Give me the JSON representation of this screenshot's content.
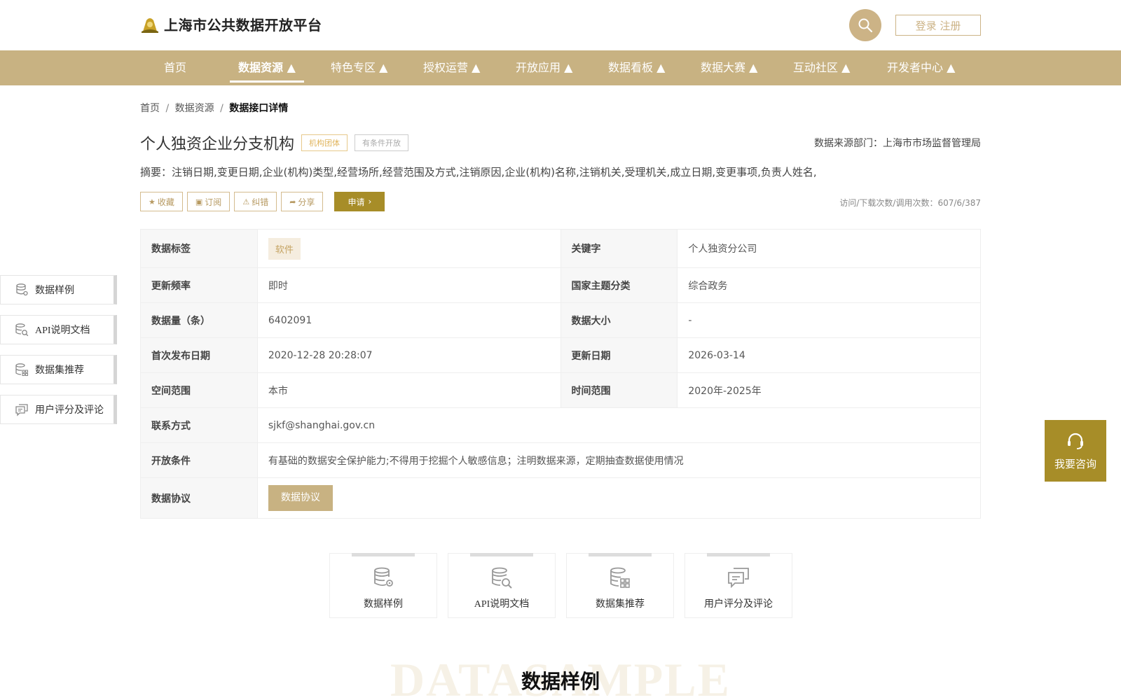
{
  "header": {
    "logo_text": "上海市公共数据开放平台",
    "login_label": "登录 注册"
  },
  "nav": [
    {
      "label": "首页"
    },
    {
      "label": "数据资源 ▲"
    },
    {
      "label": "特色专区 ▲"
    },
    {
      "label": "授权运营 ▲"
    },
    {
      "label": "开放应用 ▲"
    },
    {
      "label": "数据看板 ▲"
    },
    {
      "label": "数据大赛 ▲"
    },
    {
      "label": "互动社区 ▲"
    },
    {
      "label": "开发者中心 ▲"
    }
  ],
  "nav_active": "数据资源",
  "breadcrumb": {
    "home": "首页",
    "sep1": "/",
    "section": "数据资源",
    "sep2": "/",
    "current": "数据接口详情"
  },
  "detail": {
    "title": "个人独资企业分支机构",
    "tag_org": "机构团体",
    "tag_cond": "有条件开放",
    "source_dept": "数据来源部门：上海市市场监督管理局",
    "summary": "摘要：注销日期,变更日期,企业(机构)类型,经营场所,经营范围及方式,注销原因,企业(机构)名称,注销机关,受理机关,成立日期,变更事项,负责人姓名,",
    "stats": "访问/下载次数/调用次数：607/6/387"
  },
  "actions": {
    "favorite": "收藏",
    "subscribe": "订阅",
    "report": "纠错",
    "share": "分享",
    "apply": "申请"
  },
  "table": {
    "data_tag_label": "数据标签",
    "data_tag_value": "软件",
    "keyword_label": "关键字",
    "keyword_value": "个人独资分公司",
    "update_freq_label": "更新频率",
    "update_freq_value": "即时",
    "theme_label": "国家主题分类",
    "theme_value": "综合政务",
    "count_label": "数据量（条）",
    "count_value": "6402091",
    "size_label": "数据大小",
    "size_value": "-",
    "first_pub_label": "首次发布日期",
    "first_pub_value": "2020-12-28 20:28:07",
    "update_date_label": "更新日期",
    "update_date_value": "2026-03-14",
    "space_label": "空间范围",
    "space_value": "本市",
    "time_label": "时间范围",
    "time_value": "2020年-2025年",
    "contact_label": "联系方式",
    "contact_value": "sjkf@shanghai.gov.cn",
    "open_cond_label": "开放条件",
    "open_cond_value": "有基础的数据安全保护能力;不得用于挖掘个人敏感信息；注明数据来源，定期抽查数据使用情况",
    "protocol_label": "数据协议",
    "protocol_button": "数据协议"
  },
  "side_nav": [
    {
      "label": "数据样例"
    },
    {
      "label": "API说明文档"
    },
    {
      "label": "数据集推荐"
    },
    {
      "label": "用户评分及评论"
    }
  ],
  "consult": "我要咨询",
  "cards": [
    {
      "label": "数据样例"
    },
    {
      "label": "API说明文档"
    },
    {
      "label": "数据集推荐"
    },
    {
      "label": "用户评分及评论"
    }
  ],
  "section": {
    "bg_text": "DATASAMPLE",
    "title": "数据样例"
  },
  "colors": {
    "brand": "#c8b282",
    "accent": "#a78d28"
  },
  "icons": {
    "logo": "logo-emblem-icon",
    "search": "search-icon",
    "consult": "headset-icon"
  }
}
